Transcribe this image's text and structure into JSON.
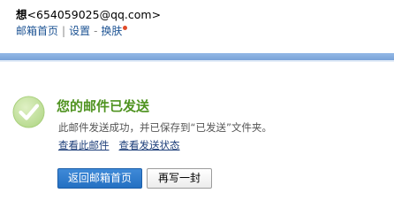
{
  "header": {
    "user_name": "想",
    "user_email": "<654059025@qq.com>",
    "links": {
      "home": "邮箱首页",
      "divider": "|",
      "settings": "设置",
      "dash": "-",
      "skin": "换肤"
    },
    "skin_dot_color": "#e04b2a"
  },
  "result": {
    "icon": "check-circle-icon",
    "title": "您的邮件已发送",
    "description": "此邮件发送成功，并已保存到“已发送”文件夹。",
    "view_mail_link": "查看此邮件",
    "view_status_link": "查看发送状态"
  },
  "buttons": {
    "back_home": "返回邮箱首页",
    "write_another": "再写一封"
  },
  "colors": {
    "title_green": "#4f9320",
    "link_blue": "#1e5494",
    "primary_button": "#2f7cd0",
    "header_bar": "#86ade0"
  }
}
